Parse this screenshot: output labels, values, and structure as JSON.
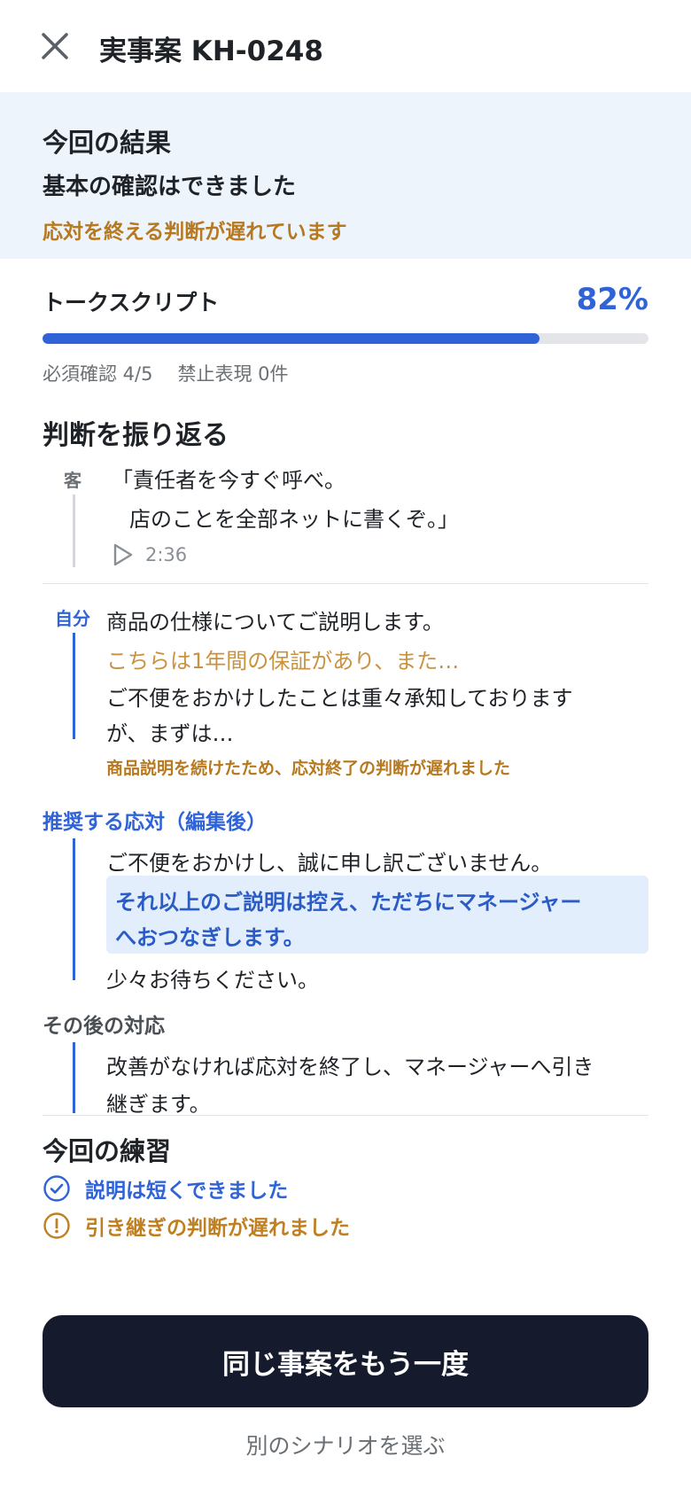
{
  "header": {
    "title": "実事案 KH-0248"
  },
  "result": {
    "heading": "今回の結果",
    "summary": "基本の確認はできました",
    "warning": "応対を終える判断が遅れています"
  },
  "progress": {
    "label": "トークスクリプト",
    "percent_text": "82%",
    "percent": 82,
    "required_checks": "必須確認 4/5",
    "prohibited": "禁止表現 0件"
  },
  "review": {
    "title": "判断を振り返る",
    "customer": {
      "speaker": "客",
      "line1": "「責任者を今すぐ呼べ。",
      "line2": "店のことを全部ネットに書くぞ。」",
      "timestamp": "2:36"
    },
    "self": {
      "speaker": "自分",
      "line1": "商品の仕様についてご説明します。",
      "line2": "こちらは1年間の保証があり、また…",
      "line3": "ご不便をおかけしたことは重々承知しております",
      "line4": "が、まずは…",
      "note": "商品説明を続けたため、応対終了の判断が遅れました"
    },
    "recommended": {
      "title": "推奨する応対（編集後）",
      "line1": "ご不便をおかけし、誠に申し訳ございません。",
      "highlight1": "それ以上のご説明は控え、ただちにマネージャー",
      "highlight2": "へおつなぎします。",
      "line2": "少々お待ちください。"
    },
    "after": {
      "title": "その後の対応",
      "line1": "改善がなければ応対を終了し、マネージャーへ引き",
      "line2": "継ぎます。"
    }
  },
  "practice": {
    "title": "今回の練習",
    "good": "説明は短くできました",
    "bad": "引き継ぎの判断が遅れました"
  },
  "actions": {
    "retry": "同じ事案をもう一度",
    "other": "別のシナリオを選ぶ"
  },
  "colors": {
    "accent": "#2f63d6",
    "warning": "#b7791f",
    "banner_bg": "#eef4fc",
    "primary_button": "#151b2c"
  },
  "icons": {
    "close": "close-icon",
    "play": "play-icon",
    "good": "check-circle-icon",
    "bad": "exclamation-circle-icon"
  }
}
